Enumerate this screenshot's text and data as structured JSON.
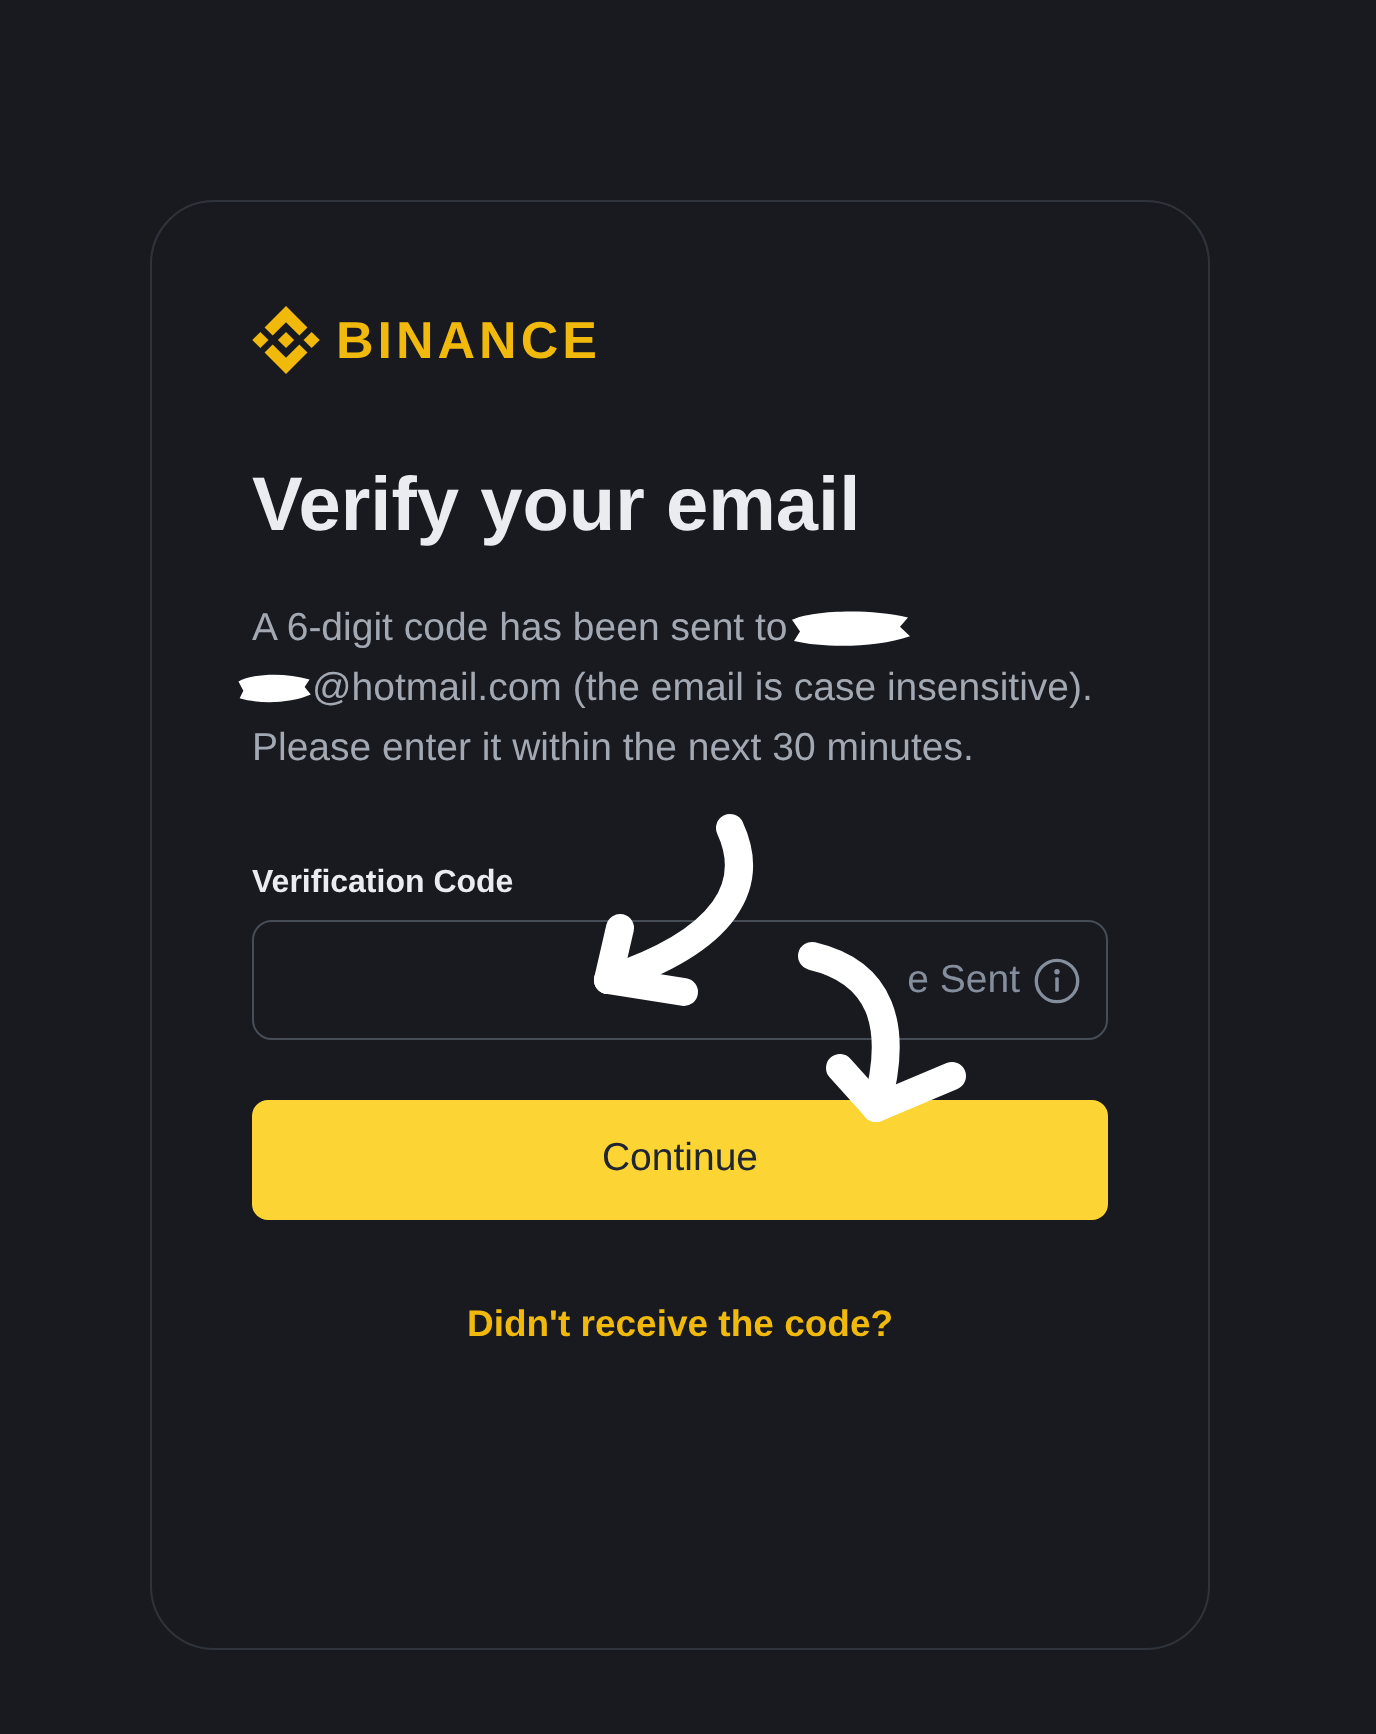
{
  "logo": {
    "text": "BINANCE"
  },
  "title": "Verify your email",
  "message": [
    {
      "text": "A 6-digit code has been sent to",
      "redacted_before": false,
      "redacted_after": true
    },
    {
      "text": "@hotmail.com (the email is case insensitive).",
      "redacted_before": true,
      "redacted_after": false
    },
    {
      "text": "Please enter it within the next 30 minutes.",
      "redacted_before": false,
      "redacted_after": false
    }
  ],
  "code_field": {
    "label": "Verification Code",
    "status": "e Sent"
  },
  "primary_button": {
    "label": "Continue"
  },
  "resend_link": {
    "label": "Didn't receive the code?"
  }
}
